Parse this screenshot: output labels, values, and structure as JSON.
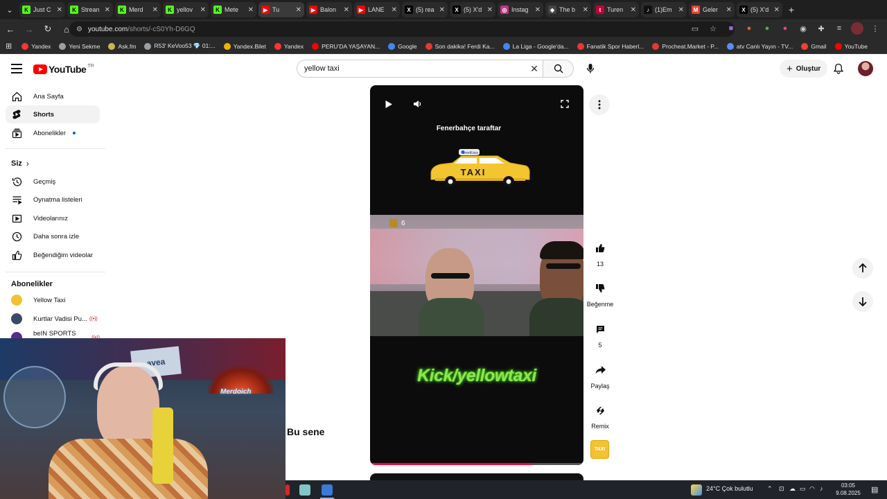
{
  "tabs": [
    {
      "title": "Just C",
      "color": "#53fc18",
      "glyph": "K"
    },
    {
      "title": "Strean",
      "color": "#53fc18",
      "glyph": "K"
    },
    {
      "title": "Merd",
      "color": "#53fc18",
      "glyph": "K"
    },
    {
      "title": "yellov",
      "color": "#53fc18",
      "glyph": "K"
    },
    {
      "title": "Mete",
      "color": "#53fc18",
      "glyph": "K"
    },
    {
      "title": "Tu",
      "color": "#ff0000",
      "glyph": "▶"
    },
    {
      "title": "Balon",
      "color": "#ff0000",
      "glyph": "▶"
    },
    {
      "title": "LANE",
      "color": "#ff0000",
      "glyph": "▶"
    },
    {
      "title": "(5) rea",
      "color": "#000000",
      "glyph": "X"
    },
    {
      "title": "(5) X'd",
      "color": "#000000",
      "glyph": "X"
    },
    {
      "title": "Instag",
      "color": "#c13584",
      "glyph": "◎"
    },
    {
      "title": "The b",
      "color": "#444444",
      "glyph": "◆"
    },
    {
      "title": "Turen",
      "color": "#c4003a",
      "glyph": "t"
    },
    {
      "title": "(1)Em",
      "color": "#111111",
      "glyph": "♪"
    },
    {
      "title": "Geler",
      "color": "#ea4335",
      "glyph": "M"
    },
    {
      "title": "(5) X'd",
      "color": "#000000",
      "glyph": "X"
    }
  ],
  "url": {
    "host": "youtube.com",
    "path": "/shorts/-cS0Yh-D6GQ"
  },
  "bookmarks": [
    {
      "label": "Yandex",
      "color": "#ff3333"
    },
    {
      "label": "Yeni Sekme",
      "color": "#9aa0a6"
    },
    {
      "label": "Ask.fm",
      "color": "#c9b458"
    },
    {
      "label": "R53' KeVoo53 💎 01:...",
      "color": "#9aa0a6"
    },
    {
      "label": "Yandex.Bilet",
      "color": "#f0b400"
    },
    {
      "label": "Yandex",
      "color": "#ff3333"
    },
    {
      "label": "PERU'DA YAŞAYAN...",
      "color": "#ff0000"
    },
    {
      "label": "Google",
      "color": "#4285f4"
    },
    {
      "label": "Son dakika! Ferdi Ka...",
      "color": "#e53935"
    },
    {
      "label": "La Liga - Google'da...",
      "color": "#4285f4"
    },
    {
      "label": "Fanatik Spor Haberl...",
      "color": "#e53935"
    },
    {
      "label": "Procheat.Market - P...",
      "color": "#e53935"
    },
    {
      "label": "atv Canlı Yayın - TV...",
      "color": "#5b8def"
    },
    {
      "label": "Gmail",
      "color": "#ea4335"
    },
    {
      "label": "YouTube",
      "color": "#ff0000"
    }
  ],
  "masthead": {
    "logo": "YouTube",
    "country": "TR",
    "search_value": "yellow taxi",
    "create_label": "Oluştur"
  },
  "sidebar": {
    "main": [
      {
        "label": "Ana Sayfa",
        "icon": "home-icon"
      },
      {
        "label": "Shorts",
        "icon": "shorts-icon"
      },
      {
        "label": "Abonelikler",
        "icon": "subscriptions-icon"
      }
    ],
    "you_title": "Siz",
    "you": [
      {
        "label": "Geçmiş",
        "icon": "history-icon"
      },
      {
        "label": "Oynatma listeleri",
        "icon": "playlists-icon"
      },
      {
        "label": "Videolarınız",
        "icon": "your-videos-icon"
      },
      {
        "label": "Daha sonra izle",
        "icon": "watch-later-icon"
      },
      {
        "label": "Beğendiğim videolar",
        "icon": "liked-icon"
      }
    ],
    "subs_title": "Abonelikler",
    "subs": [
      {
        "label": "Yellow Taxi",
        "color": "#f1c232"
      },
      {
        "label": "Kurtlar Vadisi Pu...",
        "color": "#3a4a66"
      },
      {
        "label": "beIN SPORTS Tü...",
        "color": "#5b2a86"
      }
    ]
  },
  "player": {
    "caption": "Fenerbahçe taraftar",
    "taxi_label": "TAXI",
    "taxi_sign": "StreetEasy",
    "gift_count": "6",
    "promo_text": "Kick/yellowtaxi",
    "progress": 0.76
  },
  "actions": {
    "like_count": "13",
    "dislike_label": "Beğenme",
    "comment_count": "5",
    "share_label": "Paylaş",
    "remix_label": "Remix",
    "channel_thumb": "TAXI"
  },
  "overlay_text": "Bu sene",
  "webcam": {
    "neon_sign": "Merdoich",
    "banner": "avea"
  },
  "taskbar": {
    "weather": "24°C  Çok bulutlu",
    "time": "03:05",
    "date": "9.08.2025"
  }
}
